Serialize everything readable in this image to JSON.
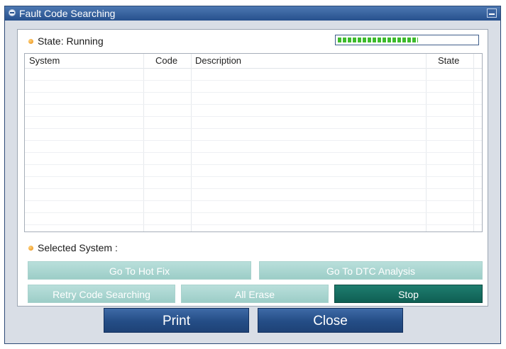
{
  "window": {
    "title": "Fault Code Searching"
  },
  "status": {
    "label": "State: Running",
    "progress_fraction": 0.58
  },
  "table": {
    "columns": [
      "System",
      "Code",
      "Description",
      "State"
    ],
    "rows": []
  },
  "selected_system": {
    "label": "Selected System :"
  },
  "buttons": {
    "hot_fix": "Go To Hot Fix",
    "dtc_analysis": "Go To DTC Analysis",
    "retry": "Retry Code Searching",
    "all_erase": "All Erase",
    "stop": "Stop",
    "print": "Print",
    "close": "Close"
  },
  "colors": {
    "title_bar": "#26508d",
    "progress_segment": "#3dbb2c",
    "disabled_button": "#9ccdc7",
    "active_button": "#0f5f53",
    "main_button": "#244d86"
  }
}
